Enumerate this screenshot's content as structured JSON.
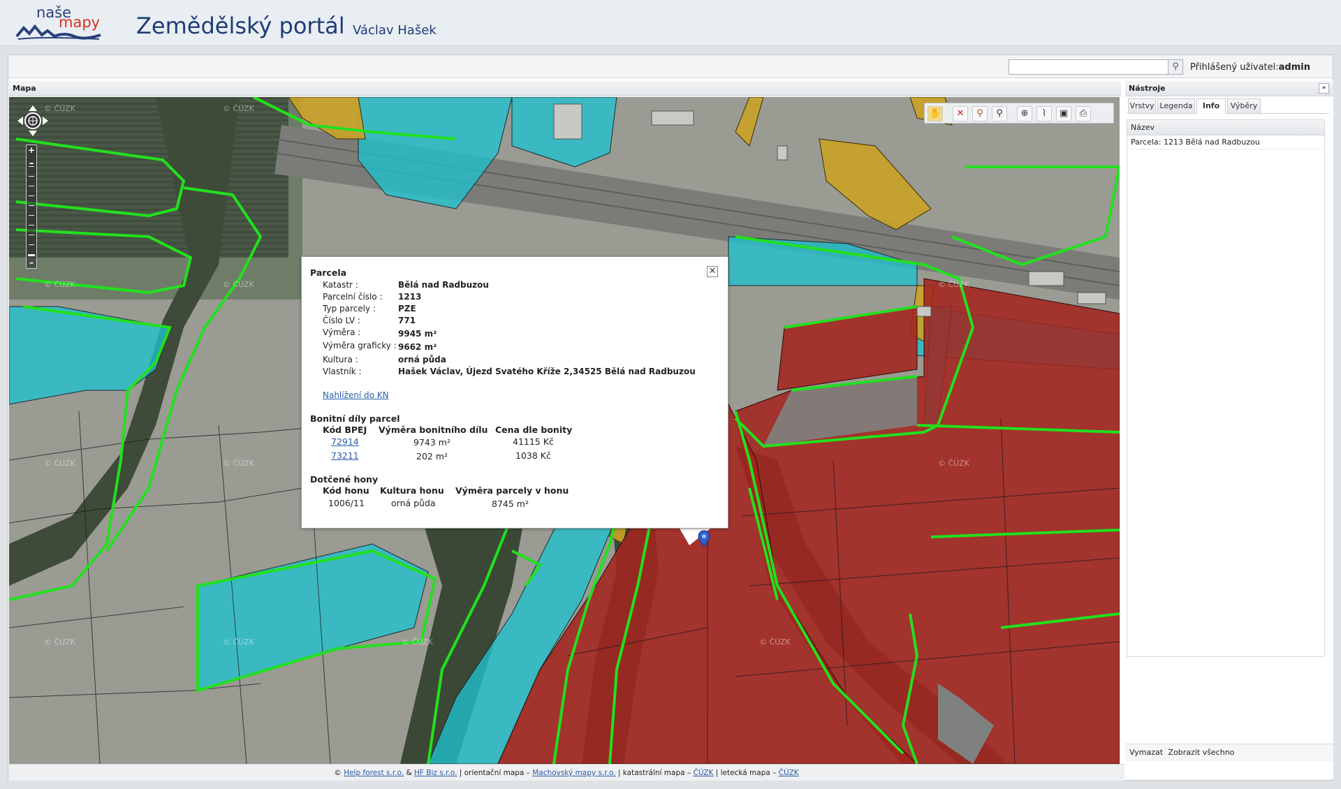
{
  "header": {
    "logo_top": "naše",
    "logo_bottom": "mapy",
    "title": "Zemědělský portál",
    "user_name": "Václav Hašek"
  },
  "topbar": {
    "search_value": "",
    "login_label": "Přihlášený uživatel:",
    "login_user": "admin"
  },
  "map_panel": {
    "title": "Mapa",
    "watermark": "© ČÚZK"
  },
  "toolbar": {
    "icons": [
      "pan-hand-icon",
      "delete-icon",
      "zoom-box-icon",
      "zoom-out-icon",
      "measure-length-icon",
      "measure-area-icon",
      "measure-perimeter-icon",
      "print-icon"
    ]
  },
  "popup": {
    "title": "Parcela",
    "fields": [
      {
        "label": "Katastr :",
        "value": "Bělá nad Radbuzou"
      },
      {
        "label": "Parcelní číslo :",
        "value": "1213"
      },
      {
        "label": "Typ parcely :",
        "value": "PZE"
      },
      {
        "label": "Číslo LV :",
        "value": "771"
      },
      {
        "label": "Výměra :",
        "value": "9945 m²"
      },
      {
        "label": "Výměra graficky :",
        "value": "9662 m²"
      },
      {
        "label": "Kultura :",
        "value": "orná půda"
      },
      {
        "label": "Vlastník :",
        "value": "Hašek Václav, Újezd Svatého Kříže 2,34525 Bělá nad Radbuzou"
      }
    ],
    "link": "Nahlížení do KN",
    "bonity": {
      "title": "Bonitní díly parcel",
      "headers": [
        "Kód BPEJ",
        "Výměra bonitního dílu",
        "Cena dle bonity"
      ],
      "rows": [
        [
          "72914",
          "9743 m²",
          "41115 Kč"
        ],
        [
          "73211",
          "202 m²",
          "1038 Kč"
        ]
      ]
    },
    "hony": {
      "title": "Dotčené hony",
      "headers": [
        "Kód honu",
        "Kultura honu",
        "Výměra parcely v honu"
      ],
      "rows": [
        [
          "1006/11",
          "orná půda",
          "8745 m²"
        ]
      ]
    }
  },
  "right_panel": {
    "title": "Nástroje",
    "tabs": [
      "Vrstvy",
      "Legenda",
      "Info",
      "Výběry"
    ],
    "active_tab": "Info",
    "grid_header": "Název",
    "rows": [
      "Parcela: 1213 Bělá nad Radbuzou"
    ],
    "footer_clear": "Vymazat",
    "footer_show_all": "Zobrazit všechno"
  },
  "footer": {
    "prefix": "©",
    "link1": "Help forest s.r.o.",
    "amp": "&",
    "link2": "HF Biz s.r.o.",
    "t1": "| orientační mapa –",
    "link3": "Machovský mapy s.r.o.",
    "t2": "| katastrální mapa –",
    "link4": "ČÚZK",
    "t3": "| letecká mapa –",
    "link5": "ČÚZK"
  },
  "colors": {
    "parcel_red": "#a3241f",
    "parcel_cyan": "#1fc2cf",
    "parcel_yellow": "#c9a227",
    "hon_boundary": "#22e01e",
    "title_blue": "#1f3c78"
  }
}
